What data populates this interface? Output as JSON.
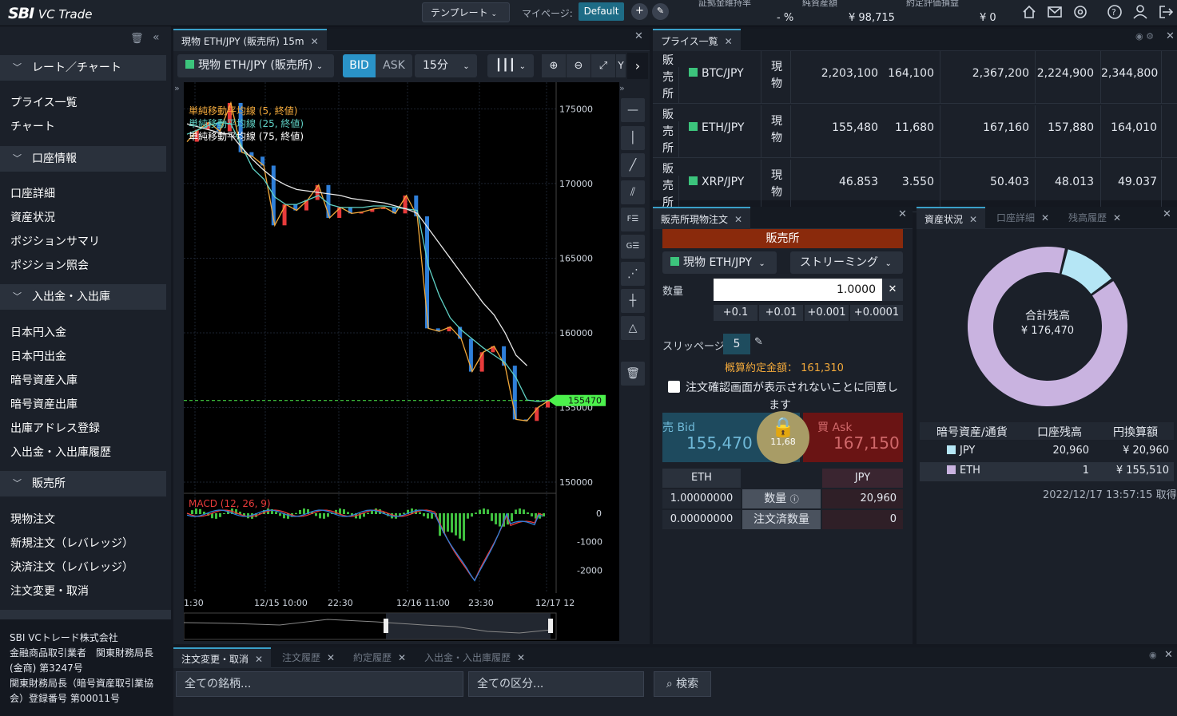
{
  "top": {
    "logo": "SBI",
    "logo_sub": "VC Trade",
    "template_label": "テンプレート",
    "mypage_label": "マイページ:",
    "mypage_value": "Default",
    "margin_label": "証拠金維持率",
    "margin_value": "- %",
    "net_label": "純資産額",
    "net_value": "¥ 98,715",
    "pnl_label": "約定評価損益",
    "pnl_value": "¥ 0"
  },
  "sidebar": {
    "sections": [
      {
        "title": "レート／チャート",
        "items": [
          "プライス一覧",
          "チャート"
        ]
      },
      {
        "title": "口座情報",
        "items": [
          "口座詳細",
          "資産状況",
          "ポジションサマリ",
          "ポジション照会"
        ]
      },
      {
        "title": "入出金・入出庫",
        "items": [
          "日本円入金",
          "日本円出金",
          "暗号資産入庫",
          "暗号資産出庫",
          "出庫アドレス登録",
          "入出金・入出庫履歴"
        ]
      },
      {
        "title": "販売所",
        "items": [
          "現物注文",
          "新規注文（レバレッジ）",
          "決済注文（レバレッジ）",
          "注文変更・取消"
        ]
      }
    ],
    "footer": [
      "SBI VCトレード株式会社",
      "金融商品取引業者　関東財務局長",
      "(金商) 第3247号",
      "関東財務局長（暗号資産取引業協",
      "会）登録番号 第00011号"
    ]
  },
  "chart_panel": {
    "tab": "現物 ETH/JPY (販売所) 15m",
    "symbol": "現物 ETH/JPY (販売所)",
    "bid": "BID",
    "ask": "ASK",
    "interval": "15分",
    "legend": [
      "単純移動平均線 (5, 終値)",
      "単純移動平均線 (25, 終値)",
      "単純移動平均線 (75, 終値)"
    ],
    "macd_label": "MACD (12, 26, 9)",
    "price_tag": "155470"
  },
  "chart_data": {
    "type": "line",
    "ylim": [
      150000,
      177000
    ],
    "y_ticks": [
      175000,
      170000,
      165000,
      160000,
      155000,
      150000
    ],
    "x_ticks": [
      "1:30",
      "12/15 10:00",
      "22:30",
      "12/16 11:00",
      "23:30",
      "12/17 12"
    ],
    "series": [
      {
        "name": "単純移動平均線 (5, 終値)",
        "color": "#f2a93b"
      },
      {
        "name": "単純移動平均線 (25, 終値)",
        "color": "#5fd0c4"
      },
      {
        "name": "単純移動平均線 (75, 終値)",
        "color": "#e8e8e8"
      }
    ],
    "price": [
      172800,
      173600,
      174100,
      173500,
      175400,
      172100,
      171800,
      171200,
      167200,
      168600,
      168200,
      168900,
      169900,
      167700,
      168400,
      168000,
      168100,
      168300,
      168400,
      168000,
      169200,
      167800,
      160300,
      160100,
      160400,
      159600,
      157400,
      158700,
      159100,
      157800,
      154200,
      154100,
      155000,
      155470
    ],
    "sma25": [
      173300,
      173600,
      173900,
      174100,
      174000,
      172500,
      171000,
      170300,
      169100,
      168600,
      168600,
      168900,
      169200,
      168600,
      168400,
      168400,
      168400,
      168500,
      168500,
      168400,
      168300,
      168200,
      164500,
      162500,
      161000,
      160200,
      159600,
      159000,
      158500,
      158000,
      157000,
      155500,
      155400,
      155470
    ],
    "sma75": [
      174000,
      173800,
      173600,
      173400,
      173300,
      172400,
      171600,
      170900,
      170300,
      169900,
      169600,
      169500,
      169400,
      169300,
      169200,
      169000,
      168900,
      168800,
      168700,
      168500,
      168300,
      168000,
      167000,
      166000,
      165000,
      164000,
      163000,
      162000,
      161200,
      160000,
      158500,
      157800
    ],
    "macd_ticks": [
      0,
      -1000,
      -2000
    ]
  },
  "price_list": {
    "tab": "プライス一覧",
    "rows": [
      {
        "venue": "販売所",
        "symbol": "BTC/JPY",
        "type": "現物",
        "bid": "2,203,100",
        "spread": "164,100",
        "ask": "2,367,200",
        "low": "2,224,900",
        "high": "2,344,800",
        "color": "#3cc47c"
      },
      {
        "venue": "販売所",
        "symbol": "ETH/JPY",
        "type": "現物",
        "bid": "155,480",
        "spread": "11,680",
        "ask": "167,160",
        "low": "157,880",
        "high": "164,010",
        "color": "#3cc47c"
      },
      {
        "venue": "販売所",
        "symbol": "XRP/JPY",
        "type": "現物",
        "bid": "46.853",
        "spread": "3.550",
        "ask": "50.403",
        "low": "48.013",
        "high": "49.037",
        "color": "#3cc47c"
      }
    ]
  },
  "order": {
    "tab": "販売所現物注文",
    "venue": "販売所",
    "symbol": "現物 ETH/JPY",
    "mode": "ストリーミング",
    "qty_label": "数量",
    "qty_value": "1.0000",
    "increments": [
      "+0.1",
      "+0.01",
      "+0.001",
      "+0.0001"
    ],
    "slip_label": "スリッページ",
    "slip_value": "5",
    "est_label": "概算約定金額：",
    "est_value": "161,310",
    "agree": "注文確認画面が表示されないことに同意し",
    "agree2": "ます",
    "sell_label": "売 Bid",
    "sell_price": "155,470",
    "buy_label": "買 Ask",
    "buy_price": "167,150",
    "lock_spread": "11,68",
    "bal_head": [
      "ETH",
      "",
      "JPY"
    ],
    "bal_rows": [
      {
        "l": "1.00000000",
        "m": "数量",
        "r": "20,960"
      },
      {
        "l": "0.00000000",
        "m": "注文済数量",
        "r": "0"
      }
    ]
  },
  "assets": {
    "tabs": [
      "資産状況",
      "口座詳細",
      "残高履歴"
    ],
    "total_label": "合計残高",
    "total_value": "¥ 176,470",
    "pie": [
      {
        "name": "JPY",
        "value": 20960,
        "color": "#b5e6f5"
      },
      {
        "name": "ETH",
        "value": 155510,
        "color": "#c9b3e0"
      }
    ],
    "headers": [
      "暗号資産/通貨",
      "口座残高",
      "円換算額"
    ],
    "rows": [
      {
        "name": "JPY",
        "bal": "20,960",
        "jpy": "¥ 20,960",
        "color": "#b5e6f5"
      },
      {
        "name": "ETH",
        "bal": "1",
        "jpy": "¥ 155,510",
        "color": "#c9b3e0"
      }
    ],
    "timestamp": "2022/12/17 13:57:15 取得"
  },
  "bottom": {
    "tabs": [
      "注文変更・取消",
      "注文履歴",
      "約定履歴",
      "入出金・入出庫履歴"
    ],
    "filter1": "全ての銘柄...",
    "filter2": "全ての区分...",
    "search": "検索"
  }
}
